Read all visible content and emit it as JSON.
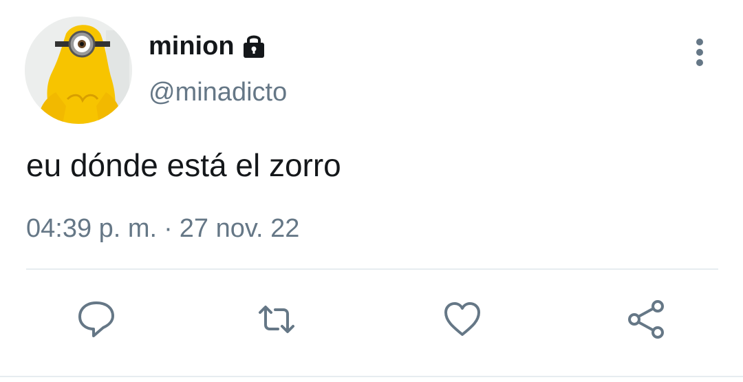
{
  "tweet": {
    "display_name": "minion",
    "handle": "@minadicto",
    "text": "eu dónde está el zorro",
    "time": "04:39 p. m.",
    "separator": "·",
    "date": "27 nov. 22"
  },
  "icons": {
    "lock": "lock-icon",
    "more": "vertical-ellipsis-icon",
    "reply": "speech-bubble-icon",
    "retweet": "retweet-icon",
    "like": "heart-icon",
    "share": "share-icon"
  },
  "colors": {
    "text_primary": "#14171a",
    "text_secondary": "#657786",
    "icon": "#657786",
    "divider": "#e6ecf0",
    "minion_yellow": "#f7c400"
  }
}
